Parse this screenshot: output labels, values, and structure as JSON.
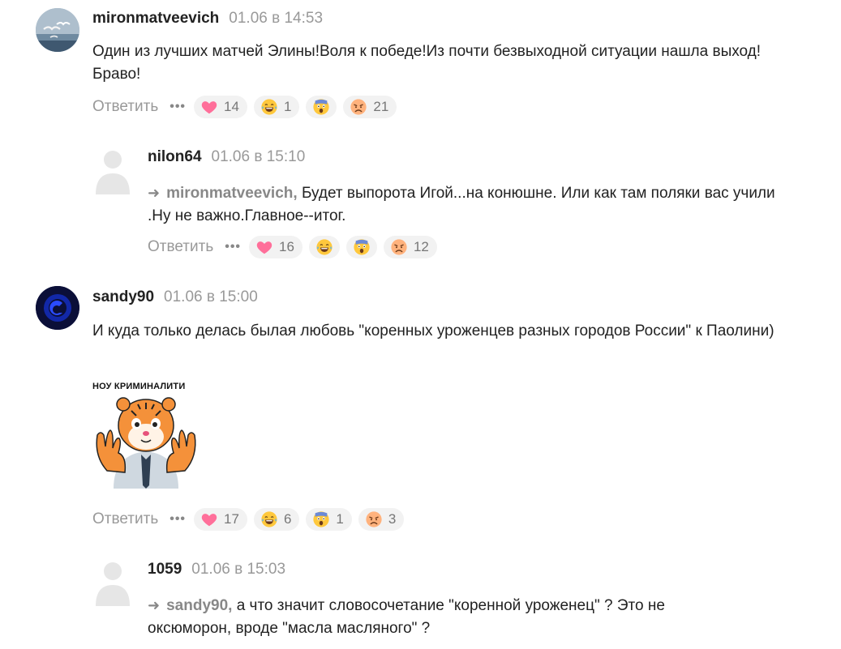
{
  "comments": [
    {
      "author": "mironmatveevich",
      "time": "01.06 в 14:53",
      "text": "Один из лучших матчей Элины!Воля к победе!Из почти безвыходной ситуации нашла выход!Браво!",
      "reply_label": "Ответить",
      "reactions": {
        "heart": "14",
        "laugh": "1",
        "shock": "",
        "sad": "21"
      },
      "avatar_icon": "seagull-photo"
    },
    {
      "author": "nilon64",
      "time": "01.06 в 15:10",
      "reply_to": "mironmatveevich,",
      "text": "Будет выпорота Игой...на конюшне. Или как там поляки вас учили .Ну не важно.Главное--итог.",
      "reply_label": "Ответить",
      "reactions": {
        "heart": "16",
        "laugh": "",
        "shock": "",
        "sad": "12"
      },
      "avatar_icon": "default-user"
    },
    {
      "author": "sandy90",
      "time": "01.06 в 15:00",
      "text": "И куда только делась былая любовь \"коренных уроженцев разных городов России\" к Паолини)",
      "sticker_caption": "НОУ КРИМИНАЛИТИ",
      "reply_label": "Ответить",
      "reactions": {
        "heart": "17",
        "laugh": "6",
        "shock": "1",
        "sad": "3"
      },
      "avatar_icon": "blue-logo"
    },
    {
      "author": "1059",
      "time": "01.06 в 15:03",
      "reply_to": "sandy90,",
      "text": "а что значит словосочетание \"коренной уроженец\" ? Это не оксюморон, вроде \"масла масляного\" ?",
      "avatar_icon": "default-user"
    }
  ],
  "icons": {
    "more": "•••",
    "reply_arrow": "➜"
  },
  "colors": {
    "heart": "#ff6f9a",
    "emoji_face": "#ffc83d",
    "sad_face": "#ffb27d",
    "muted_text": "#999999"
  }
}
